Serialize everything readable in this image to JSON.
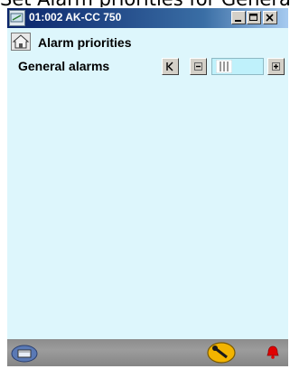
{
  "caption": "Set Alarm priorities for General alarms",
  "window": {
    "title": "01:002 AK-CC 750",
    "controls": {
      "minimize_icon": "minimize-icon",
      "maximize_icon": "maximize-icon",
      "close_icon": "close-icon"
    }
  },
  "page": {
    "home_icon": "home-icon",
    "title": "Alarm priorities"
  },
  "alarm_setting": {
    "label": "General alarms",
    "level": 0.1,
    "buttons": [
      "step-to-start",
      "step-down",
      "step-up"
    ]
  },
  "statusbar": {
    "icons": [
      "device-icon",
      "service-wrench-icon",
      "alarm-bell-icon"
    ]
  },
  "colors": {
    "titlebar": "#0a246a",
    "content_background": "#ddf6fc",
    "statusbar": "#8c8c8c",
    "alarm_bell": "#e00000",
    "wrench_badge": "#f2b400"
  }
}
